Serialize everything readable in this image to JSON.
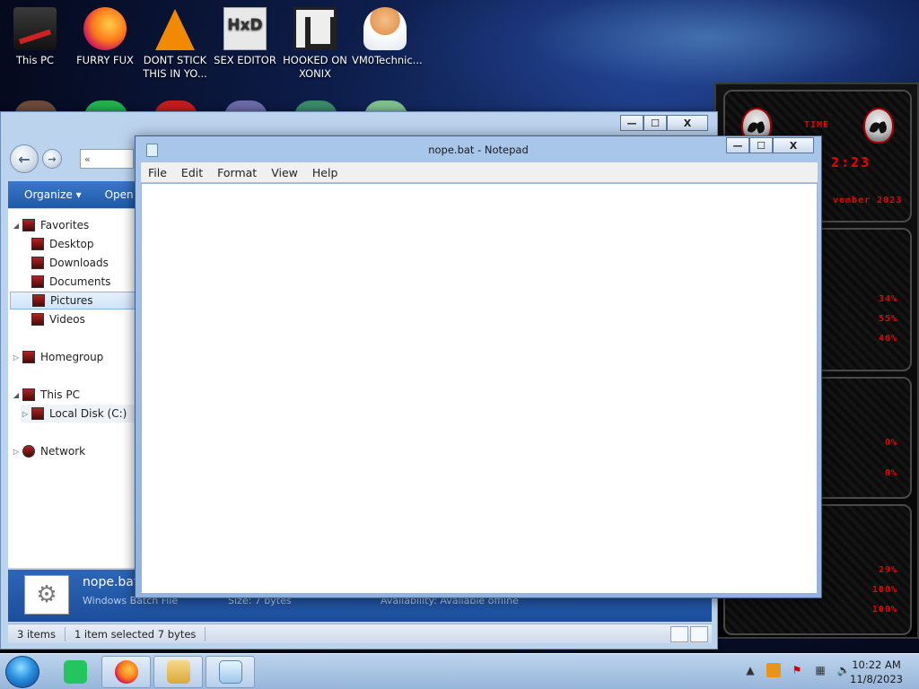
{
  "desktop": {
    "icons": [
      {
        "label": "This PC"
      },
      {
        "label": "FURRY FUX"
      },
      {
        "label": "DONT STICK THIS IN YO..."
      },
      {
        "label": "SEX EDITOR"
      },
      {
        "label": "HOOKED ON XONIX"
      },
      {
        "label": "VM0Technic..."
      }
    ]
  },
  "gadget": {
    "time_label": "TIME",
    "time_value": "2:23",
    "date_text": "vember 2023",
    "cpu_values": [
      "34%",
      "55%",
      "46%"
    ],
    "disk_values": [
      "0%",
      "0%"
    ],
    "net_values": [
      "29%",
      "100%",
      "100%"
    ]
  },
  "explorer": {
    "window_controls": {
      "min": "—",
      "max": "☐",
      "close": "X"
    },
    "address_text": "«",
    "commands": {
      "organize": "Organize ▾",
      "open": "Open"
    },
    "nav": {
      "favorites": "Favorites",
      "desktop": "Desktop",
      "downloads": "Downloads",
      "documents": "Documents",
      "pictures": "Pictures",
      "videos": "Videos",
      "homegroup": "Homegroup",
      "this_pc": "This PC",
      "local_disk": "Local Disk (C:)",
      "network": "Network"
    },
    "details": {
      "file_name": "nope.bat",
      "file_type": "Windows Batch File",
      "size": "Size:   7 bytes",
      "availability": "Availability:   Available offline"
    },
    "status": {
      "items": "3 items",
      "selected": "1 item selected  7 bytes"
    }
  },
  "notepad": {
    "title": "nope.bat - Notepad",
    "window_controls": {
      "min": "—",
      "max": "☐",
      "close": "X"
    },
    "menu": {
      "file": "File",
      "edit": "Edit",
      "format": "Format",
      "view": "View",
      "help": "Help"
    },
    "content": ""
  },
  "taskbar": {
    "clock": {
      "time": "10:22 AM",
      "date": "11/8/2023"
    }
  },
  "colors": {
    "accent": "#1f5aa8",
    "gadget_red": "#e00000"
  }
}
